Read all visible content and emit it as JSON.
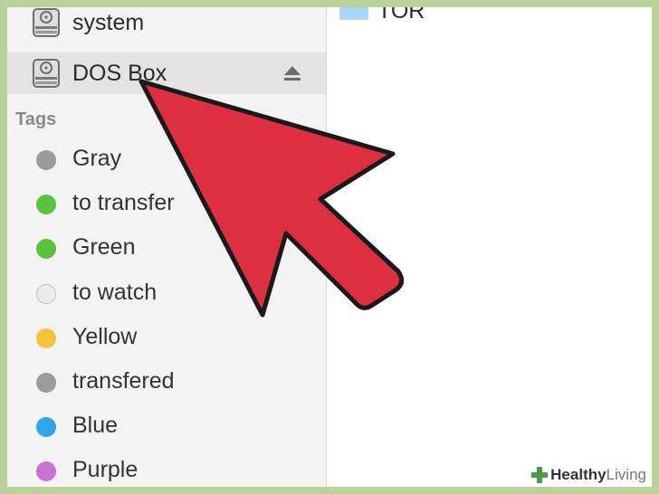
{
  "devices": [
    {
      "label": "system",
      "icon": "hard-drive-icon"
    },
    {
      "label": "DOS Box",
      "icon": "hard-drive-icon",
      "eject_icon": "eject-icon",
      "selected": true
    }
  ],
  "tags_section_title": "Tags",
  "tags": [
    {
      "label": "Gray",
      "color": "#9b9b9b"
    },
    {
      "label": "to transfer",
      "color": "#5cc341"
    },
    {
      "label": "Green",
      "color": "#5cc341"
    },
    {
      "label": "to watch",
      "color": "#ececec"
    },
    {
      "label": "Yellow",
      "color": "#f3c33a"
    },
    {
      "label": "transfered",
      "color": "#9b9b9b"
    },
    {
      "label": "Blue",
      "color": "#2fa6e8"
    },
    {
      "label": "Purple",
      "color": "#c873d6"
    }
  ],
  "content": {
    "folder_label": "TOR",
    "folder_icon": "folder-icon"
  },
  "overlay": {
    "arrow_color": "#dc2f3f",
    "arrow_icon": "pointer-arrow-icon"
  },
  "watermark": {
    "strong": "Healthy",
    "light": " Living",
    "icon": "cross-icon"
  }
}
